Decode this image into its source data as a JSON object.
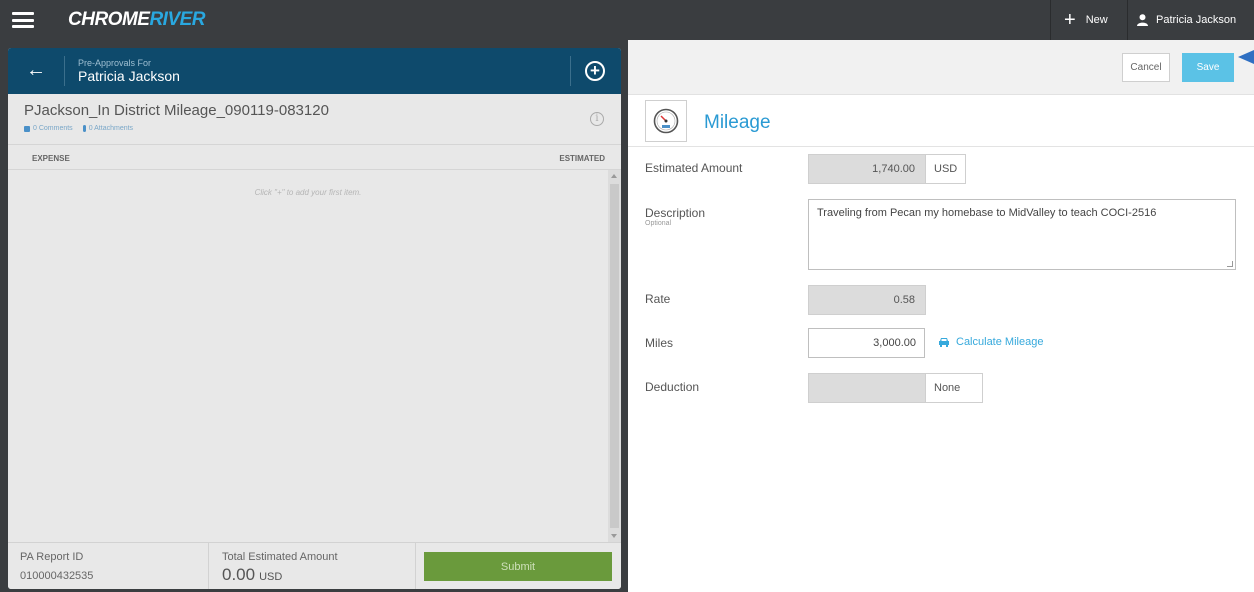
{
  "topbar": {
    "brand_part1": "CHROME",
    "brand_part2": "RIVER",
    "new_label": "New",
    "user_name": "Patricia Jackson"
  },
  "left": {
    "pre_approvals_for": "Pre-Approvals For",
    "owner_name": "Patricia Jackson",
    "report_title": "PJackson_In District Mileage_090119-083120",
    "comments": "0 Comments",
    "attachments": "0 Attachments",
    "col_expense": "EXPENSE",
    "col_estimated": "ESTIMATED",
    "empty_hint": "Click \"+\" to add your first item.",
    "pa_report_id_label": "PA Report ID",
    "pa_report_id": "010000432535",
    "total_label": "Total Estimated Amount",
    "total_value": "0.00",
    "total_currency": "USD",
    "submit_label": "Submit"
  },
  "right": {
    "cancel_label": "Cancel",
    "save_label": "Save",
    "title": "Mileage",
    "estimated_amount_label": "Estimated Amount",
    "estimated_amount": "1,740.00",
    "currency": "USD",
    "description_label": "Description",
    "description_optional": "Optional",
    "description_value": "Traveling from Pecan my homebase to MidValley to teach COCI-2516",
    "rate_label": "Rate",
    "rate_value": "0.58",
    "miles_label": "Miles",
    "miles_value": "3,000.00",
    "calc_mileage_label": "Calculate Mileage",
    "deduction_label": "Deduction",
    "deduction_value": "None"
  },
  "colors": {
    "topbar": "#3a3d40",
    "panel_header": "#0e4a6c",
    "accent": "#2a9ad3",
    "save": "#5bc2e6",
    "submit": "#6a9a3c"
  }
}
